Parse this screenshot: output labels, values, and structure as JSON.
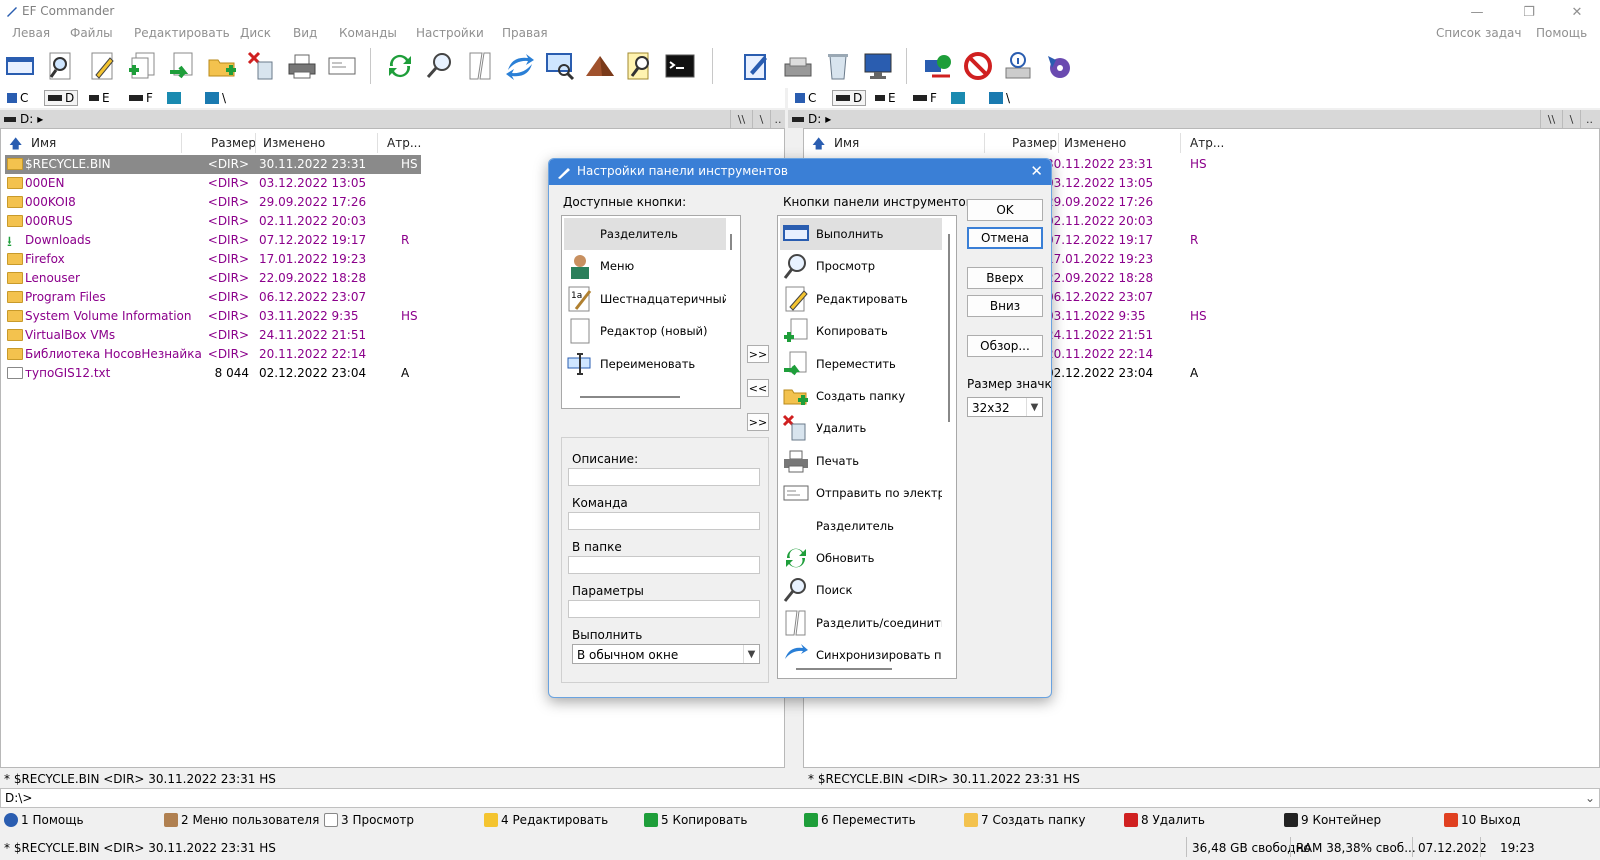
{
  "window": {
    "title": "EF Commander",
    "controls": {
      "minimize": "—",
      "restore": "❐",
      "close": "✕"
    }
  },
  "menu": {
    "left_items": [
      "Левая",
      "Файлы",
      "Редактировать",
      "Диск",
      "Вид",
      "Команды",
      "Настройки",
      "Правая"
    ],
    "right_items": [
      "Список задач",
      "Помощь"
    ]
  },
  "drives": {
    "left": [
      "C",
      "D",
      "E",
      "F",
      "\\"
    ],
    "right": [
      "C",
      "D",
      "E",
      "F",
      "\\"
    ]
  },
  "left_panel": {
    "path": "D:",
    "path_buttons": [
      "\\\\",
      "\\",
      ".."
    ],
    "columns": {
      "name": "Имя",
      "size": "Размер",
      "modified": "Изменено",
      "attr": "Атр..."
    },
    "rows": [
      {
        "name": "$RECYCLE.BIN",
        "size": "<DIR>",
        "date": "30.11.2022  23:31",
        "attr": "HS"
      },
      {
        "name": "000EN",
        "size": "<DIR>",
        "date": "03.12.2022  13:05",
        "attr": ""
      },
      {
        "name": "000KOI8",
        "size": "<DIR>",
        "date": "29.09.2022  17:26",
        "attr": ""
      },
      {
        "name": "000RUS",
        "size": "<DIR>",
        "date": "02.11.2022  20:03",
        "attr": ""
      },
      {
        "name": "Downloads",
        "size": "<DIR>",
        "date": "07.12.2022  19:17",
        "attr": "R"
      },
      {
        "name": "Firefox",
        "size": "<DIR>",
        "date": "17.01.2022  19:23",
        "attr": ""
      },
      {
        "name": "Lenouser",
        "size": "<DIR>",
        "date": "22.09.2022  18:28",
        "attr": ""
      },
      {
        "name": "Program Files",
        "size": "<DIR>",
        "date": "06.12.2022  23:07",
        "attr": ""
      },
      {
        "name": "System Volume Information",
        "size": "<DIR>",
        "date": "03.11.2022  9:35",
        "attr": "HS"
      },
      {
        "name": "VirtualBox VMs",
        "size": "<DIR>",
        "date": "24.11.2022  21:51",
        "attr": ""
      },
      {
        "name": "Библиотека НосовНезнайка",
        "size": "<DIR>",
        "date": "20.11.2022  22:14",
        "attr": ""
      },
      {
        "name": "тупоGIS12.txt",
        "size": "8 044",
        "date": "02.12.2022  23:04",
        "attr": "A"
      }
    ],
    "status": "* $RECYCLE.BIN    <DIR>  30.11.2022  23:31  HS"
  },
  "right_panel": {
    "path": "D:",
    "path_buttons": [
      "\\\\",
      "\\",
      ".."
    ],
    "columns": {
      "name": "Имя",
      "size": "Размер",
      "modified": "Изменено",
      "attr": "Атр..."
    },
    "rows": [
      {
        "date": "30.11.2022  23:31",
        "attr": "HS"
      },
      {
        "date": "03.12.2022  13:05",
        "attr": ""
      },
      {
        "date": "29.09.2022  17:26",
        "attr": ""
      },
      {
        "date": "02.11.2022  20:03",
        "attr": ""
      },
      {
        "date": "07.12.2022  19:17",
        "attr": "R"
      },
      {
        "date": "17.01.2022  19:23",
        "attr": ""
      },
      {
        "date": "22.09.2022  18:28",
        "attr": ""
      },
      {
        "date": "06.12.2022  23:07",
        "attr": ""
      },
      {
        "date": "03.11.2022  9:35",
        "attr": "HS"
      },
      {
        "date": "24.11.2022  21:51",
        "attr": ""
      },
      {
        "date": "20.11.2022  22:14",
        "attr": ""
      },
      {
        "date": "02.12.2022  23:04",
        "attr": "A"
      }
    ],
    "status": "* $RECYCLE.BIN    <DIR>  30.11.2022  23:31  HS"
  },
  "command_line": "D:\\>",
  "fkeys": [
    {
      "label": "1 Помощь"
    },
    {
      "label": "2 Меню пользователя"
    },
    {
      "label": "3 Просмотр"
    },
    {
      "label": "4 Редактировать"
    },
    {
      "label": "5 Копировать"
    },
    {
      "label": "6 Переместить"
    },
    {
      "label": "7 Создать папку"
    },
    {
      "label": "8 Удалить"
    },
    {
      "label": "9 Контейнер"
    },
    {
      "label": "10 Выход"
    }
  ],
  "bottom": {
    "selection": "* $RECYCLE.BIN    <DIR>  30.11.2022  23:31  HS",
    "free": "36,48 GB свободно",
    "ram": "RAM 38,38% своб...",
    "date": "07.12.2022",
    "time": "19:23"
  },
  "dialog": {
    "title": "Настройки панели инструментов",
    "available_label": "Доступные кнопки:",
    "toolbar_label": "Кнопки панели инструментов:",
    "available": [
      "Разделитель",
      "Меню",
      "Шестнадцатеричный ре",
      "Редактор (новый)",
      "Переименовать"
    ],
    "toolbar_buttons": [
      "Выполнить",
      "Просмотр",
      "Редактировать",
      "Копировать",
      "Переместить",
      "Создать папку",
      "Удалить",
      "Печать",
      "Отправить по электрон",
      "Разделитель",
      "Обновить",
      "Поиск",
      "Разделить/соединить",
      "Синхронизировать папк"
    ],
    "move_buttons": [
      ">>",
      "<<",
      ">>"
    ],
    "ok": "OK",
    "cancel": "Отмена",
    "up": "Вверх",
    "down": "Вниз",
    "browse": "Обзор...",
    "icon_size_label": "Размер значка",
    "icon_size": "32x32",
    "description_label": "Описание:",
    "command_label": "Команда",
    "folder_label": "В папке",
    "params_label": "Параметры",
    "run_label": "Выполнить",
    "run_mode": "В обычном окне"
  }
}
